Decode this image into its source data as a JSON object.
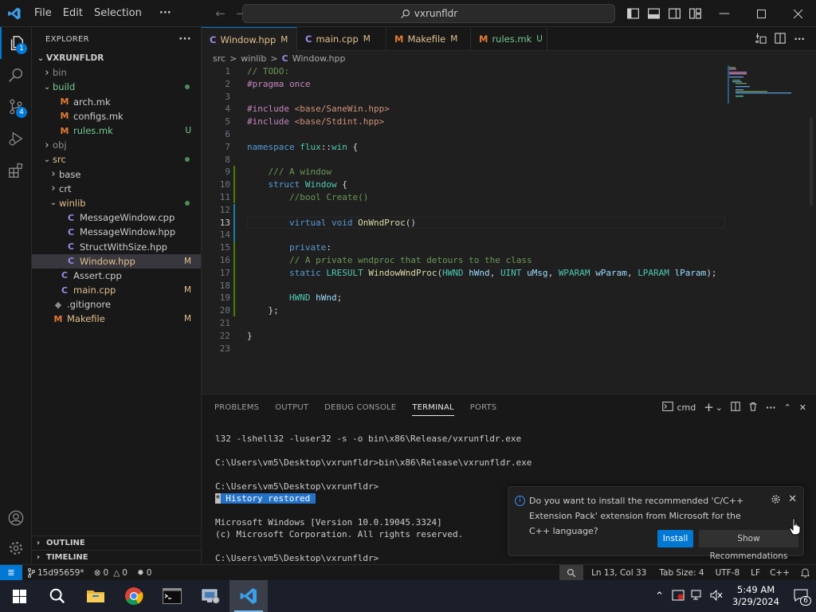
{
  "titlebar": {
    "menu": [
      "File",
      "Edit",
      "Selection",
      "···"
    ],
    "search_text": "vxrunfldr"
  },
  "activity": {
    "explorer_badge": "1",
    "scm_badge": "4"
  },
  "sidebar": {
    "header": "EXPLORER",
    "more": "···",
    "root": "VXRUNFLDR",
    "items": [
      {
        "label": "bin",
        "chev": ">",
        "depth": 1,
        "icon": "",
        "status": "",
        "color": "gray"
      },
      {
        "label": "build",
        "chev": "v",
        "depth": 1,
        "icon": "",
        "status": "dot",
        "color": "green"
      },
      {
        "label": "arch.mk",
        "chev": "",
        "depth": 2,
        "icon": "M",
        "status": "",
        "color": "normal"
      },
      {
        "label": "configs.mk",
        "chev": "",
        "depth": 2,
        "icon": "M",
        "status": "",
        "color": "normal"
      },
      {
        "label": "rules.mk",
        "chev": "",
        "depth": 2,
        "icon": "M",
        "status": "U",
        "color": "green"
      },
      {
        "label": "obj",
        "chev": ">",
        "depth": 1,
        "icon": "",
        "status": "",
        "color": "gray"
      },
      {
        "label": "src",
        "chev": "v",
        "depth": 1,
        "icon": "",
        "status": "dot",
        "color": "yellow"
      },
      {
        "label": "base",
        "chev": ">",
        "depth": 2,
        "icon": "",
        "status": "",
        "color": "normal"
      },
      {
        "label": "crt",
        "chev": ">",
        "depth": 2,
        "icon": "",
        "status": "",
        "color": "normal"
      },
      {
        "label": "winlib",
        "chev": "v",
        "depth": 2,
        "icon": "",
        "status": "dot",
        "color": "yellow"
      },
      {
        "label": "MessageWindow.cpp",
        "chev": "",
        "depth": 3,
        "icon": "C",
        "status": "",
        "color": "normal"
      },
      {
        "label": "MessageWindow.hpp",
        "chev": "",
        "depth": 3,
        "icon": "C",
        "status": "",
        "color": "normal"
      },
      {
        "label": "StructWithSize.hpp",
        "chev": "",
        "depth": 3,
        "icon": "C",
        "status": "",
        "color": "normal"
      },
      {
        "label": "Window.hpp",
        "chev": "",
        "depth": 3,
        "icon": "C",
        "status": "M",
        "color": "yellow",
        "selected": true
      },
      {
        "label": "Assert.cpp",
        "chev": "",
        "depth": 2,
        "icon": "C",
        "status": "",
        "color": "normal"
      },
      {
        "label": "main.cpp",
        "chev": "",
        "depth": 2,
        "icon": "C",
        "status": "M",
        "color": "yellow"
      },
      {
        "label": ".gitignore",
        "chev": "",
        "depth": 1,
        "icon": "◆",
        "status": "",
        "color": "normal"
      },
      {
        "label": "Makefile",
        "chev": "",
        "depth": 1,
        "icon": "M",
        "status": "M",
        "color": "yellow"
      }
    ],
    "outline": "OUTLINE",
    "timeline": "TIMELINE"
  },
  "tabs": [
    {
      "label": "Window.hpp",
      "status": "M",
      "icon": "C",
      "active": true,
      "dirty": true
    },
    {
      "label": "main.cpp",
      "status": "M",
      "icon": "C",
      "active": false
    },
    {
      "label": "Makefile",
      "status": "M",
      "icon": "M",
      "active": false
    },
    {
      "label": "rules.mk",
      "status": "U",
      "icon": "M",
      "active": false
    }
  ],
  "breadcrumb": [
    "src",
    ">",
    "winlib",
    ">",
    "Window.hpp"
  ],
  "editor": {
    "current_line": 13,
    "lines": [
      [
        [
          "c",
          "// TODO:"
        ]
      ],
      [
        [
          "p",
          "#pragma"
        ],
        [
          "n",
          " "
        ],
        [
          "p",
          "once"
        ]
      ],
      [],
      [
        [
          "p",
          "#include"
        ],
        [
          "n",
          " "
        ],
        [
          "s",
          "<base/SaneWin.hpp>"
        ]
      ],
      [
        [
          "p",
          "#include"
        ],
        [
          "n",
          " "
        ],
        [
          "s",
          "<base/Stdint.hpp>"
        ]
      ],
      [],
      [
        [
          "k",
          "namespace"
        ],
        [
          "n",
          " "
        ],
        [
          "t",
          "flux"
        ],
        [
          "n",
          "::"
        ],
        [
          "t",
          "win"
        ],
        [
          "n",
          " {"
        ]
      ],
      [],
      [
        [
          "n",
          "    "
        ],
        [
          "c",
          "/// A window"
        ]
      ],
      [
        [
          "n",
          "    "
        ],
        [
          "k",
          "struct"
        ],
        [
          "n",
          " "
        ],
        [
          "t",
          "Window"
        ],
        [
          "n",
          " {"
        ]
      ],
      [
        [
          "n",
          "        "
        ],
        [
          "c",
          "//bool Create()"
        ]
      ],
      [],
      [
        [
          "n",
          "        "
        ],
        [
          "k",
          "virtual"
        ],
        [
          "n",
          " "
        ],
        [
          "k",
          "void"
        ],
        [
          "n",
          " "
        ],
        [
          "f",
          "OnWndProc"
        ],
        [
          "n",
          "()"
        ]
      ],
      [],
      [
        [
          "n",
          "        "
        ],
        [
          "k",
          "private"
        ],
        [
          "n",
          ":"
        ]
      ],
      [
        [
          "n",
          "        "
        ],
        [
          "c",
          "// A private wndproc that detours to the class"
        ]
      ],
      [
        [
          "n",
          "        "
        ],
        [
          "k",
          "static"
        ],
        [
          "n",
          " "
        ],
        [
          "t",
          "LRESULT"
        ],
        [
          "n",
          " "
        ],
        [
          "f",
          "WindowWndProc"
        ],
        [
          "n",
          "("
        ],
        [
          "t",
          "HWND"
        ],
        [
          "n",
          " "
        ],
        [
          "v",
          "hWnd"
        ],
        [
          "n",
          ", "
        ],
        [
          "t",
          "UINT"
        ],
        [
          "n",
          " "
        ],
        [
          "v",
          "uMsg"
        ],
        [
          "n",
          ", "
        ],
        [
          "t",
          "WPARAM"
        ],
        [
          "n",
          " "
        ],
        [
          "v",
          "wParam"
        ],
        [
          "n",
          ", "
        ],
        [
          "t",
          "LPARAM"
        ],
        [
          "n",
          " "
        ],
        [
          "v",
          "lParam"
        ],
        [
          "n",
          ");"
        ]
      ],
      [],
      [
        [
          "n",
          "        "
        ],
        [
          "t",
          "HWND"
        ],
        [
          "n",
          " "
        ],
        [
          "v",
          "hWnd"
        ],
        [
          "n",
          ";"
        ]
      ],
      [
        [
          "n",
          "    };"
        ]
      ],
      [],
      [
        [
          "n",
          "}"
        ]
      ],
      []
    ]
  },
  "panel": {
    "tabs": [
      "PROBLEMS",
      "OUTPUT",
      "DEBUG CONSOLE",
      "TERMINAL",
      "PORTS"
    ],
    "active_tab": "TERMINAL",
    "terminal_name": "cmd",
    "terminal_lines": [
      "l32 -lshell32 -luser32 -s -o bin\\x86\\Release/vxrunfldr.exe",
      "",
      "C:\\Users\\vm5\\Desktop\\vxrunfldr>bin\\x86\\Release\\vxrunfldr.exe",
      "",
      "C:\\Users\\vm5\\Desktop\\vxrunfldr>",
      "__HIST__",
      "",
      "Microsoft Windows [Version 10.0.19045.3324]",
      "(c) Microsoft Corporation. All rights reserved.",
      "",
      "C:\\Users\\vm5\\Desktop\\vxrunfldr>"
    ],
    "history_marker": "*",
    "history_text": " History restored "
  },
  "notification": {
    "text": "Do you want to install the recommended 'C/C++ Extension Pack' extension from Microsoft for the C++ language?",
    "install": "Install",
    "show_recommendations": "Show Recommendations"
  },
  "statusbar": {
    "branch": "15d95659*",
    "errors": "0",
    "warnings": "0",
    "ports": "0",
    "position": "Ln 13, Col 33",
    "tab_size": "Tab Size: 4",
    "encoding": "UTF-8",
    "eol": "LF",
    "language": "C++"
  },
  "taskbar": {
    "time": "5:49 AM",
    "date": "3/29/2024",
    "notif_count": "6"
  },
  "colors": {
    "accent": "#0078d4",
    "modified": "#e2c08d",
    "untracked": "#73c991"
  }
}
